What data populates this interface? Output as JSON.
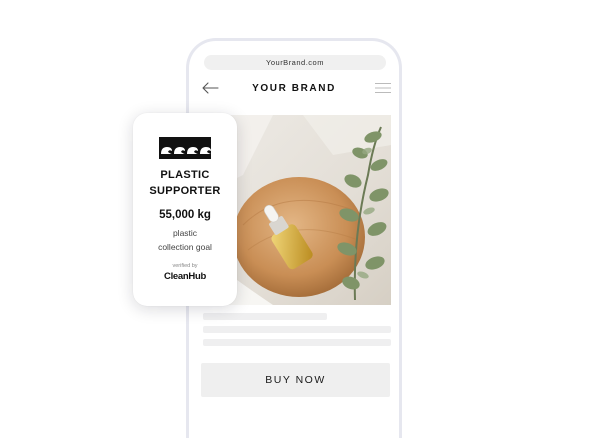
{
  "browser": {
    "url": "YourBrand.com"
  },
  "nav": {
    "back_icon": "arrow-left-icon",
    "brand": "YOUR BRAND",
    "menu_icon": "hamburger-menu-icon"
  },
  "product": {
    "image": "serum-dropper-bottle-with-eucalyptus-photo",
    "buy_label": "BUY NOW"
  },
  "badge": {
    "icon": "wave-icon",
    "title_line1": "PLASTIC",
    "title_line2": "SUPPORTER",
    "amount": "55,000 kg",
    "desc_line1": "plastic",
    "desc_line2": "collection goal",
    "verified": "verified by",
    "verifier": "CleanHub"
  },
  "colors": {
    "phone_frame": "#e6e7ef",
    "placeholder": "#efeff0",
    "text_dark": "#111111"
  }
}
